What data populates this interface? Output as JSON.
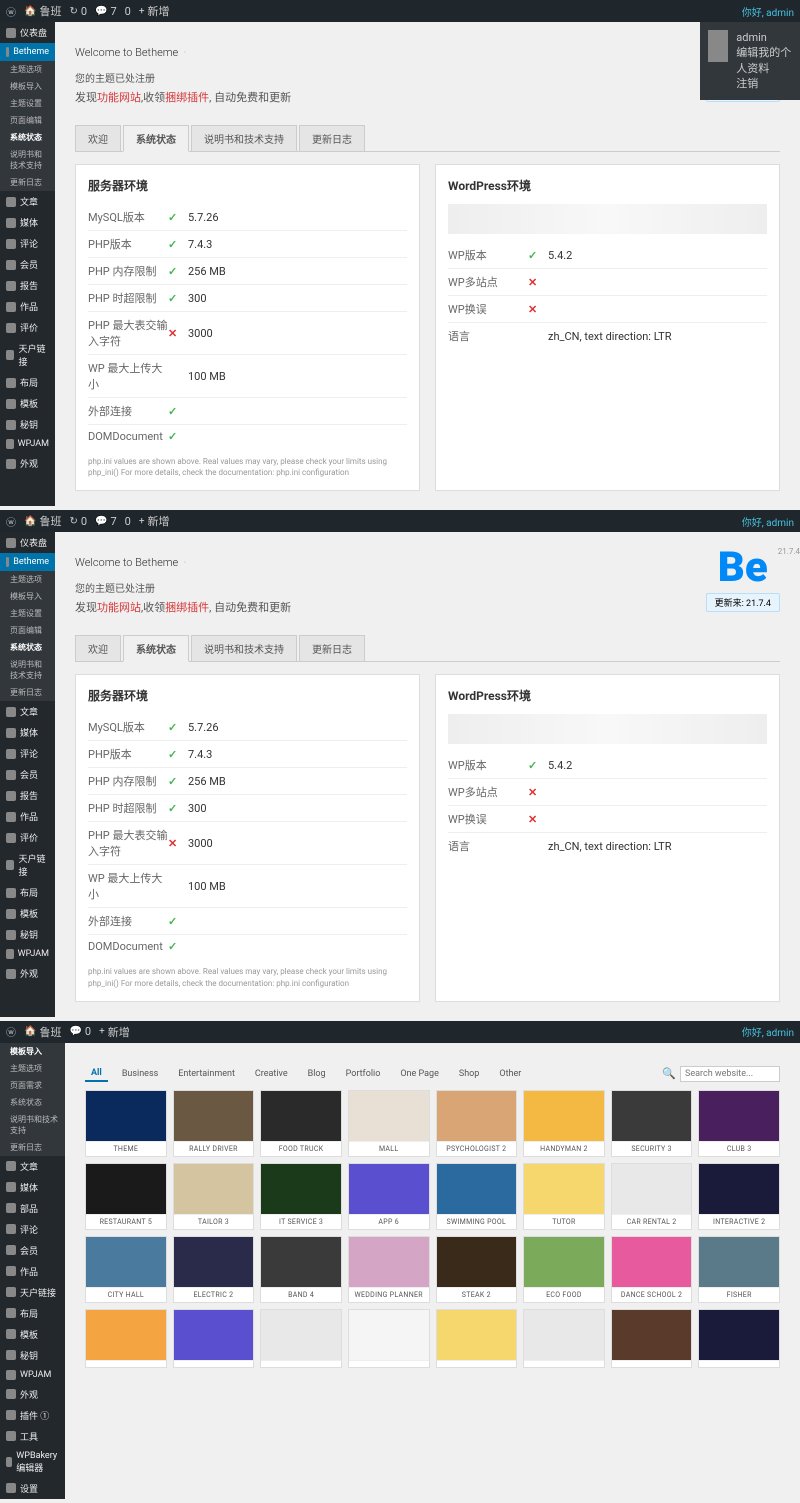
{
  "adminbar": {
    "items": [
      "鲁班",
      "0",
      "7",
      "0",
      "新增"
    ],
    "right": "你好, admin"
  },
  "user_popup": {
    "name": "admin",
    "line1": "编辑我的个人资料",
    "line2": "注销"
  },
  "sidebar_main": [
    {
      "icon": "dash",
      "label": "仪表盘",
      "active": false
    },
    {
      "icon": "be",
      "label": "Betheme",
      "active": true
    }
  ],
  "sidebar_sub": [
    {
      "label": "主题选项"
    },
    {
      "label": "模板导入"
    },
    {
      "label": "主题设置"
    },
    {
      "label": "页面编辑"
    },
    {
      "label": "系统状态",
      "active": true
    },
    {
      "label": "说明书和技术支持"
    },
    {
      "label": "更新日志"
    }
  ],
  "sidebar_rest": [
    {
      "label": "文章"
    },
    {
      "label": "媒体"
    },
    {
      "label": "评论"
    },
    {
      "label": "会员"
    },
    {
      "label": "报告"
    },
    {
      "label": "作品"
    },
    {
      "label": "评价"
    },
    {
      "label": "天户链接"
    },
    {
      "label": "布局"
    },
    {
      "label": "模板"
    },
    {
      "label": "秘钥"
    },
    {
      "label": "WPJAM"
    },
    {
      "label": "外观"
    }
  ],
  "welcome": {
    "title": "Welcome to Betheme",
    "sub": "您的主题已处注册",
    "desc_pre": "发现",
    "link1": "功能网站",
    "mid": ",收领",
    "link2": "捆绑插件",
    "desc_post": ", 自动免费和更新"
  },
  "be": {
    "logo": "Be",
    "version": "21.7.4",
    "badge": "更新来: 21.7.4"
  },
  "tabs": [
    {
      "label": "欢迎"
    },
    {
      "label": "系统状态",
      "active": true
    },
    {
      "label": "说明书和技术支持"
    },
    {
      "label": "更新日志"
    }
  ],
  "server": {
    "title": "服务器环境",
    "rows": [
      {
        "label": "MySQL版本",
        "check": "ok",
        "value": "5.7.26"
      },
      {
        "label": "PHP版本",
        "check": "ok",
        "value": "7.4.3"
      },
      {
        "label": "PHP 内存限制",
        "check": "ok",
        "value": "256 MB"
      },
      {
        "label": "PHP 时超限制",
        "check": "ok",
        "value": "300"
      },
      {
        "label": "PHP 最大表交输入字符",
        "check": "err",
        "value": "3000"
      },
      {
        "label": "WP 最大上传大小",
        "check": "",
        "value": "100 MB"
      },
      {
        "label": "外部连接",
        "check": "ok",
        "value": ""
      },
      {
        "label": "DOMDocument",
        "check": "ok",
        "value": ""
      }
    ],
    "note": "php.ini values are shown above. Real values may vary, please check your limits using php_ini() For more details, check the documentation: php.ini configuration"
  },
  "wp": {
    "title": "WordPress环境",
    "rows": [
      {
        "label": "WP版本",
        "check": "ok",
        "value": "5.4.2"
      },
      {
        "label": "WP多站点",
        "check": "err",
        "value": ""
      },
      {
        "label": "WP换误",
        "check": "err",
        "value": ""
      },
      {
        "label": "语言",
        "check": "",
        "value": "zh_CN, text direction: LTR"
      }
    ]
  },
  "sidebar3": [
    {
      "label": "模板导入",
      "active": true
    },
    {
      "label": "主题选项"
    },
    {
      "label": "页面需求"
    },
    {
      "label": "系统状态"
    },
    {
      "label": "说明书和技术支持"
    },
    {
      "label": "更新日志"
    }
  ],
  "sidebar3_rest": [
    {
      "label": "文章"
    },
    {
      "label": "媒体"
    },
    {
      "label": "部品"
    },
    {
      "label": "评论"
    },
    {
      "label": "会员"
    },
    {
      "label": "作品"
    },
    {
      "label": "天户链接"
    },
    {
      "label": "布局"
    },
    {
      "label": "模板"
    },
    {
      "label": "秘钥"
    },
    {
      "label": "WPJAM"
    },
    {
      "label": "外观"
    },
    {
      "label": "插件 ①"
    },
    {
      "label": "工具"
    },
    {
      "label": "WPBakery编辑器"
    },
    {
      "label": "设置"
    }
  ],
  "filters": [
    {
      "label": "All",
      "active": true
    },
    {
      "label": "Business"
    },
    {
      "label": "Entertainment"
    },
    {
      "label": "Creative"
    },
    {
      "label": "Blog"
    },
    {
      "label": "Portfolio"
    },
    {
      "label": "One Page"
    },
    {
      "label": "Shop"
    },
    {
      "label": "Other"
    }
  ],
  "search": {
    "placeholder": "Search website...",
    "icon_label": "🔍"
  },
  "templates": [
    {
      "label": "THEME",
      "bg": "#0a2a5e"
    },
    {
      "label": "RALLY DRIVER",
      "bg": "#6b5842"
    },
    {
      "label": "FOOD TRUCK",
      "bg": "#2a2a2a"
    },
    {
      "label": "MALL",
      "bg": "#e8e0d5"
    },
    {
      "label": "PSYCHOLOGIST 2",
      "bg": "#d9a574"
    },
    {
      "label": "HANDYMAN 2",
      "bg": "#f4b942"
    },
    {
      "label": "SECURITY 3",
      "bg": "#3a3a3a"
    },
    {
      "label": "CLUB 3",
      "bg": "#4a1f5e"
    },
    {
      "label": "RESTAURANT 5",
      "bg": "#1a1a1a"
    },
    {
      "label": "TAILOR 3",
      "bg": "#d4c5a0"
    },
    {
      "label": "IT SERVICE 3",
      "bg": "#1a3a1a"
    },
    {
      "label": "APP 6",
      "bg": "#5a4fcf"
    },
    {
      "label": "SWIMMING POOL",
      "bg": "#2a6a9e"
    },
    {
      "label": "TUTOR",
      "bg": "#f5d76e"
    },
    {
      "label": "CAR RENTAL 2",
      "bg": "#e8e8e8"
    },
    {
      "label": "INTERACTIVE 2",
      "bg": "#1a1a3a"
    },
    {
      "label": "CITY HALL",
      "bg": "#4a7a9e"
    },
    {
      "label": "ELECTRIC 2",
      "bg": "#2a2a4a"
    },
    {
      "label": "BAND 4",
      "bg": "#3a3a3a"
    },
    {
      "label": "WEDDING PLANNER",
      "bg": "#d4a5c5"
    },
    {
      "label": "STEAK 2",
      "bg": "#3a2a1a"
    },
    {
      "label": "ECO FOOD",
      "bg": "#7aaa5a"
    },
    {
      "label": "DANCE SCHOOL 2",
      "bg": "#e85a9e"
    },
    {
      "label": "FISHER",
      "bg": "#5a7a8a"
    },
    {
      "label": "",
      "bg": "#f4a542"
    },
    {
      "label": "",
      "bg": "#5a4fcf"
    },
    {
      "label": "",
      "bg": "#e8e8e8"
    },
    {
      "label": "",
      "bg": "#f5f5f5"
    },
    {
      "label": "",
      "bg": "#f5d76e"
    },
    {
      "label": "",
      "bg": "#e8e8e8"
    },
    {
      "label": "",
      "bg": "#5a3a2a"
    },
    {
      "label": "",
      "bg": "#1a1a3a"
    }
  ]
}
